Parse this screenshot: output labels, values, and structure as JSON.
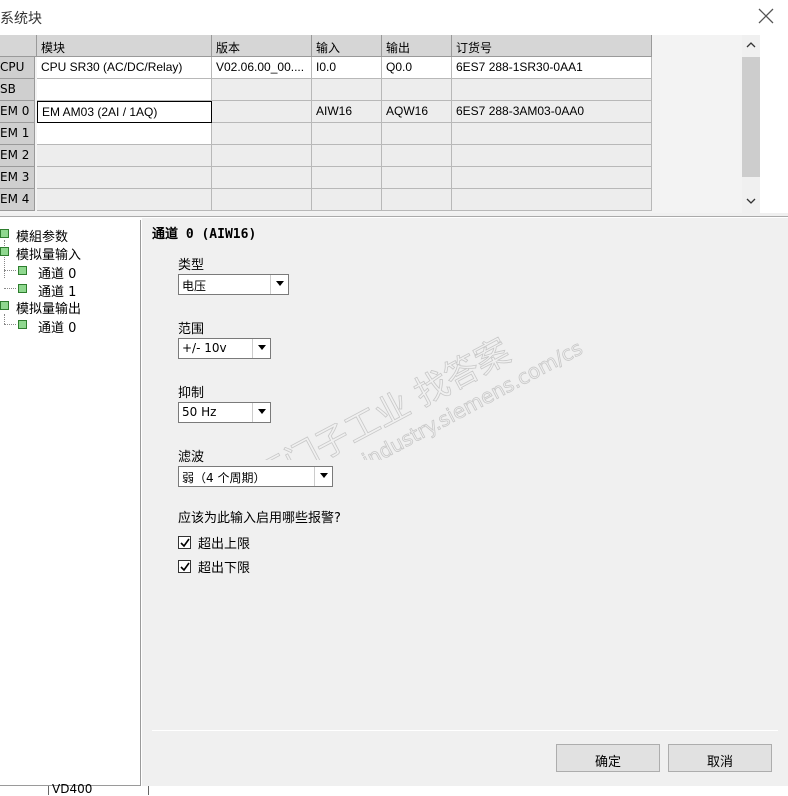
{
  "window": {
    "title": "系统块"
  },
  "table": {
    "headers": [
      "模块",
      "版本",
      "输入",
      "输出",
      "订货号"
    ],
    "rows": [
      {
        "label": "CPU",
        "module": "CPU SR30 (AC/DC/Relay)",
        "version": "V02.06.00_00....",
        "input": "I0.0",
        "output": "Q0.0",
        "order": "6ES7 288-1SR30-0AA1"
      },
      {
        "label": "SB",
        "module": "",
        "version": "",
        "input": "",
        "output": "",
        "order": ""
      },
      {
        "label": "EM 0",
        "module": "EM AM03 (2AI / 1AQ)",
        "version": "",
        "input": "AIW16",
        "output": "AQW16",
        "order": "6ES7 288-3AM03-0AA0"
      },
      {
        "label": "EM 1",
        "module": "",
        "version": "",
        "input": "",
        "output": "",
        "order": ""
      },
      {
        "label": "EM 2",
        "module": "",
        "version": "",
        "input": "",
        "output": "",
        "order": ""
      },
      {
        "label": "EM 3",
        "module": "",
        "version": "",
        "input": "",
        "output": "",
        "order": ""
      },
      {
        "label": "EM 4",
        "module": "",
        "version": "",
        "input": "",
        "output": "",
        "order": ""
      }
    ]
  },
  "tree": {
    "items": [
      {
        "label": "模組参数"
      },
      {
        "label": "模拟量输入"
      },
      {
        "label": "通道 0"
      },
      {
        "label": "通道 1"
      },
      {
        "label": "模拟量输出"
      },
      {
        "label": "通道 0"
      }
    ]
  },
  "panel": {
    "channel_title": "通道 0 (AIW16)",
    "type_label": "类型",
    "type_value": "电压",
    "range_label": "范围",
    "range_value": "+/- 10v",
    "reject_label": "抑制",
    "reject_value": "50 Hz",
    "filter_label": "滤波",
    "filter_value": "弱（4 个周期）",
    "alarm_question": "应该为此输入启用哪些报警?",
    "alarm_upper_label": "超出上限",
    "alarm_upper_checked": true,
    "alarm_lower_label": "超出下限",
    "alarm_lower_checked": true
  },
  "buttons": {
    "ok": "确定",
    "cancel": "取消"
  },
  "background": {
    "partial_text": "VD400"
  },
  "watermark": {
    "line1": "西门子工业 找答案",
    "line2": "support.industry.siemens.com/cs"
  },
  "colors": {
    "module_icon_fill": "#8fd88f",
    "module_icon_border": "#2e7d2e",
    "panel_bg": "#f0f0f0"
  }
}
